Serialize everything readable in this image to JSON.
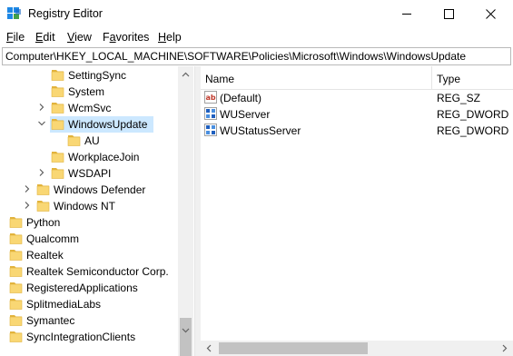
{
  "window": {
    "title": "Registry Editor",
    "app_icon": "registry-editor-icon"
  },
  "menu": {
    "file": {
      "accel": "F",
      "rest": "ile"
    },
    "edit": {
      "accel": "E",
      "rest": "dit"
    },
    "view": {
      "accel": "V",
      "rest": "iew"
    },
    "favorites": {
      "pre": "F",
      "accel": "a",
      "rest": "vorites"
    },
    "help": {
      "accel": "H",
      "rest": "elp"
    }
  },
  "address": {
    "path": "Computer\\HKEY_LOCAL_MACHINE\\SOFTWARE\\Policies\\Microsoft\\Windows\\WindowsUpdate"
  },
  "tree": {
    "items": [
      {
        "label": "SettingSync",
        "expander": "none",
        "selected": false
      },
      {
        "label": "System",
        "expander": "none",
        "selected": false
      },
      {
        "label": "WcmSvc",
        "expander": "collapsed",
        "selected": false
      },
      {
        "label": "WindowsUpdate",
        "expander": "expanded",
        "selected": true
      },
      {
        "label": "AU",
        "expander": "none",
        "selected": false
      },
      {
        "label": "WorkplaceJoin",
        "expander": "none",
        "selected": false
      },
      {
        "label": "WSDAPI",
        "expander": "collapsed",
        "selected": false
      },
      {
        "label": "Windows Defender",
        "expander": "collapsed",
        "selected": false
      },
      {
        "label": "Windows NT",
        "expander": "collapsed",
        "selected": false
      },
      {
        "label": "Python",
        "expander": "none",
        "selected": false
      },
      {
        "label": "Qualcomm",
        "expander": "none",
        "selected": false
      },
      {
        "label": "Realtek",
        "expander": "none",
        "selected": false
      },
      {
        "label": "Realtek Semiconductor Corp.",
        "expander": "none",
        "selected": false
      },
      {
        "label": "RegisteredApplications",
        "expander": "none",
        "selected": false
      },
      {
        "label": "SplitmediaLabs",
        "expander": "none",
        "selected": false
      },
      {
        "label": "Symantec",
        "expander": "none",
        "selected": false
      },
      {
        "label": "SyncIntegrationClients",
        "expander": "none",
        "selected": false
      }
    ]
  },
  "list": {
    "columns": {
      "name": "Name",
      "type": "Type"
    },
    "rows": [
      {
        "name": "(Default)",
        "type": "REG_SZ",
        "icon": "string-value-icon"
      },
      {
        "name": "WUServer",
        "type": "REG_DWORD",
        "icon": "binary-value-icon"
      },
      {
        "name": "WUStatusServer",
        "type": "REG_DWORD",
        "icon": "binary-value-icon"
      }
    ]
  },
  "colors": {
    "selection": "#cce8ff",
    "folder": "#f9d774",
    "folder_dark": "#e2b33c",
    "scroll_track": "#f0f0f0",
    "scroll_thumb": "#c2c2c2"
  }
}
